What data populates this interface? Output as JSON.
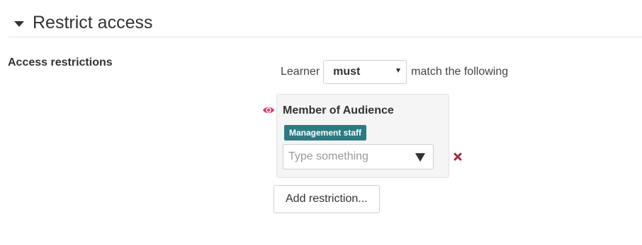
{
  "section": {
    "title": "Restrict access"
  },
  "form": {
    "row_label": "Access restrictions",
    "match_prefix": "Learner",
    "match_select_value": "must",
    "match_suffix": "match the following"
  },
  "condition": {
    "title": "Member of Audience",
    "tags": [
      "Management staff"
    ],
    "input_placeholder": "Type something",
    "input_value": ""
  },
  "buttons": {
    "add_restriction": "Add restriction..."
  },
  "colors": {
    "tag_background": "#2d7b82",
    "eye_icon": "#d63a74",
    "delete_icon": "#a42a3a"
  },
  "icons": {
    "section_toggle": "caret-down-icon",
    "visibility": "eye-icon",
    "delete": "delete-x-icon",
    "dropdown": "chevron-down-icon"
  }
}
